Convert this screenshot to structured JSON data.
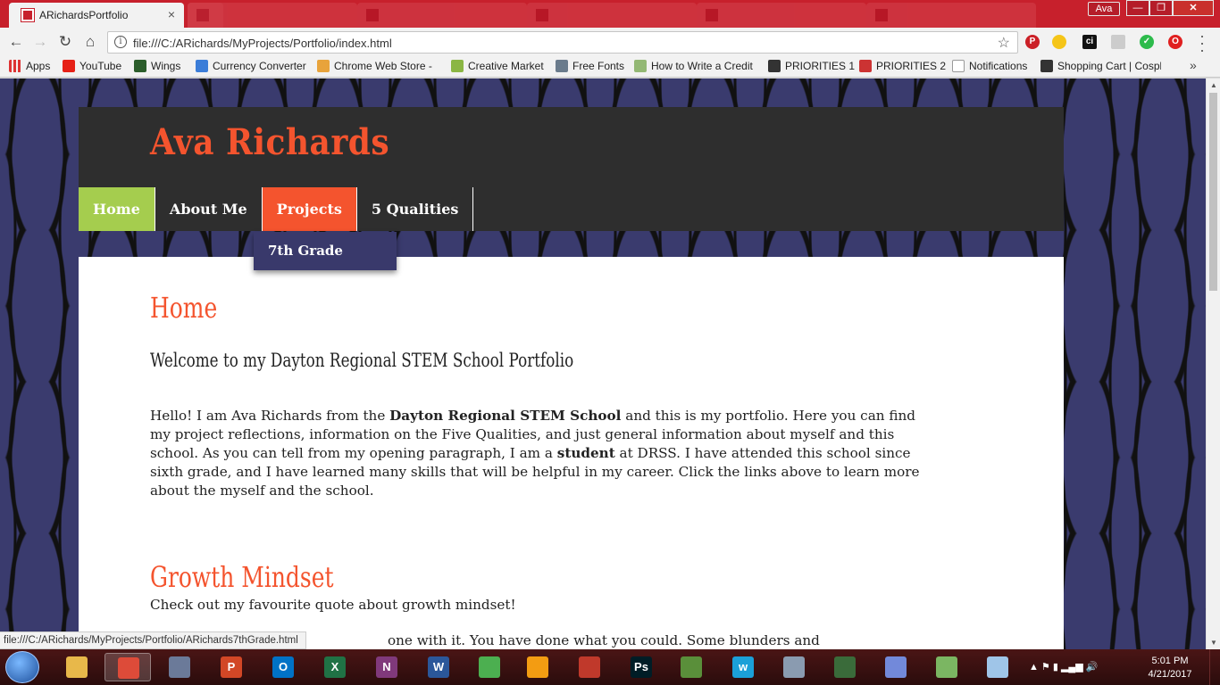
{
  "browser": {
    "tab_title": "ARichardsPortfolio",
    "tab_close": "×",
    "profile": "Ava",
    "address": "file:///C:/ARichards/MyProjects/Portfolio/index.html",
    "status_url": "file:///C:/ARichards/MyProjects/Portfolio/ARichards7thGrade.html",
    "nav": {
      "back": "←",
      "forward": "→",
      "reload": "↻",
      "home": "⌂"
    },
    "star": "☆",
    "window": {
      "minimize": "—",
      "maximize": "❐",
      "close": "✕"
    }
  },
  "bookmarks": [
    {
      "label": "Apps",
      "icon": "apps-grid-icon",
      "color": "#d33"
    },
    {
      "label": "YouTube",
      "icon": "youtube-icon",
      "color": "#e62117"
    },
    {
      "label": "Wings",
      "icon": "wings-icon",
      "color": "#2b5d2b"
    },
    {
      "label": "Currency Converter",
      "icon": "currency-icon",
      "color": "#3b7dd8"
    },
    {
      "label": "Chrome Web Store -",
      "icon": "webstore-icon",
      "color": "#e8a33b"
    },
    {
      "label": "Creative Market",
      "icon": "creative-market-icon",
      "color": "#8bb644"
    },
    {
      "label": "Free Fonts",
      "icon": "free-fonts-icon",
      "color": "#6a7b8c"
    },
    {
      "label": "How to Write a Credit",
      "icon": "wikihow-icon",
      "color": "#93b874"
    },
    {
      "label": "PRIORITIES 1",
      "icon": "dh-icon",
      "color": "#333"
    },
    {
      "label": "PRIORITIES 2",
      "icon": "priorities-icon",
      "color": "#c33"
    },
    {
      "label": "Notifications",
      "icon": "page-icon",
      "color": "#999"
    },
    {
      "label": "Shopping Cart | Cospl",
      "icon": "cart-icon",
      "color": "#333"
    }
  ],
  "bookmarks_more": "»",
  "site": {
    "title": "Ava Richards",
    "nav": [
      "Home",
      "About Me",
      "Projects",
      "5 Qualities"
    ],
    "dropdown": [
      "7th Grade"
    ],
    "home_heading": "Home",
    "welcome": "Welcome to my Dayton Regional STEM School Portfolio",
    "intro": {
      "p1": "Hello! I am Ava Richards from the ",
      "b1": "Dayton Regional STEM School",
      "p2": " and this is my portfolio. Here you can find my project reflections, information on the Five Qualities, and just general information about myself and this school. As you can tell from my opening paragraph, I am a ",
      "b2": "student",
      "p3": " at DRSS. I have attended this school since sixth grade, and I have learned many skills that will be helpful in my career. Click the links above to learn more about the myself and the school."
    },
    "growth_heading": "Growth Mindset",
    "growth_sub": "Check out my favourite quote about growth mindset!",
    "quote_fragment": "one with it. You have done what you could. Some blunders and"
  },
  "taskbar": {
    "time": "5:01 PM",
    "date": "4/21/2017",
    "apps": [
      {
        "name": "file-explorer-icon",
        "label": "",
        "color": "#e8b84a"
      },
      {
        "name": "chrome-icon",
        "label": "",
        "color": "#dd4b39",
        "active": true
      },
      {
        "name": "webcam-icon",
        "label": "",
        "color": "#6b7a99"
      },
      {
        "name": "powerpoint-icon",
        "label": "P",
        "color": "#d24726"
      },
      {
        "name": "outlook-icon",
        "label": "O",
        "color": "#0072c6"
      },
      {
        "name": "excel-icon",
        "label": "X",
        "color": "#207245"
      },
      {
        "name": "onenote-icon",
        "label": "N",
        "color": "#80397b"
      },
      {
        "name": "word-icon",
        "label": "W",
        "color": "#2b579a"
      },
      {
        "name": "sims-icon",
        "label": "",
        "color": "#4caf50"
      },
      {
        "name": "media-player-icon",
        "label": "",
        "color": "#f39c12"
      },
      {
        "name": "pencil-icon",
        "label": "",
        "color": "#c0392b"
      },
      {
        "name": "photoshop-icon",
        "label": "Ps",
        "color": "#001d26"
      },
      {
        "name": "app-badge-icon",
        "label": "",
        "color": "#5a8f3a"
      },
      {
        "name": "wattpad-icon",
        "label": "w",
        "color": "#1ba0d8"
      },
      {
        "name": "calculator-icon",
        "label": "",
        "color": "#8a9bb0"
      },
      {
        "name": "monitor-icon",
        "label": "",
        "color": "#3a6b3a"
      },
      {
        "name": "discord-icon",
        "label": "",
        "color": "#7289da"
      },
      {
        "name": "chart-app-icon",
        "label": "",
        "color": "#7bb662"
      },
      {
        "name": "notes-icon",
        "label": "",
        "color": "#9fc5e8"
      }
    ]
  }
}
